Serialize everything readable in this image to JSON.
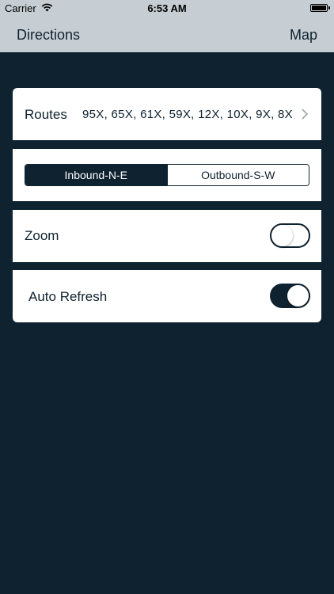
{
  "status_bar": {
    "carrier": "Carrier",
    "wifi_icon": "wifi-icon",
    "time": "6:53 AM",
    "battery_icon": "battery-icon",
    "battery_level": 1.0
  },
  "nav": {
    "left_label": "Directions",
    "right_label": "Map"
  },
  "routes": {
    "label": "Routes",
    "value": "95X, 65X, 61X, 59X, 12X, 10X, 9X, 8X",
    "chevron_icon": "chevron-right-icon"
  },
  "direction": {
    "options": [
      "Inbound-N-E",
      "Outbound-S-W"
    ],
    "selected": "Inbound-N-E"
  },
  "zoom": {
    "label": "Zoom",
    "enabled": false
  },
  "auto_refresh": {
    "label": "Auto Refresh",
    "enabled": true
  },
  "colors": {
    "background": "#0f2230",
    "bar": "#c6ced3",
    "card": "#ffffff",
    "accent": "#0f2230"
  }
}
